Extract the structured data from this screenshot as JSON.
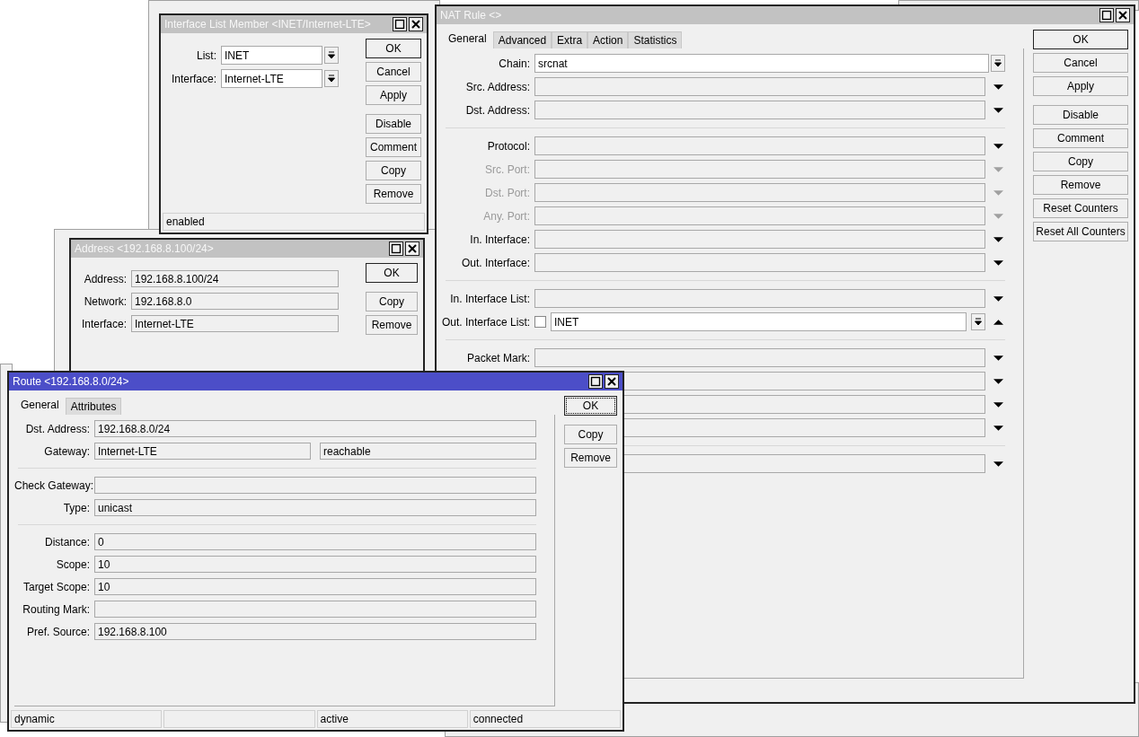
{
  "windows": [
    {
      "title": "Interface List Member <INET/Internet-LTE>",
      "active": false,
      "groups": [
        [
          {
            "kind": "combo",
            "label": "List:",
            "value": "INET",
            "disabled": false
          },
          {
            "kind": "combo",
            "label": "Interface:",
            "value": "Internet-LTE",
            "disabled": false
          }
        ]
      ],
      "button_groups": [
        [
          {
            "label": "OK",
            "default": true
          },
          {
            "label": "Cancel",
            "default": false
          },
          {
            "label": "Apply",
            "default": false
          }
        ],
        [
          {
            "label": "Disable",
            "default": false
          },
          {
            "label": "Comment",
            "default": false
          },
          {
            "label": "Copy",
            "default": false
          },
          {
            "label": "Remove",
            "default": false
          }
        ]
      ],
      "status_bar": [
        {
          "kind": "text",
          "text": "enabled"
        }
      ]
    },
    {
      "title": "NAT Rule <>",
      "active": false,
      "tabs": [
        {
          "label": "General",
          "selected": true
        },
        {
          "label": "Advanced",
          "selected": false
        },
        {
          "label": "Extra",
          "selected": false
        },
        {
          "label": "Action",
          "selected": false
        },
        {
          "label": "Statistics",
          "selected": false
        }
      ],
      "groups": [
        [
          {
            "kind": "combo",
            "label": "Chain:",
            "value": "srcnat",
            "disabled": false
          },
          {
            "kind": "dropdown",
            "label": "Src. Address:",
            "disabled": false
          },
          {
            "kind": "dropdown",
            "label": "Dst. Address:",
            "disabled": false
          }
        ],
        [
          {
            "kind": "dropdown",
            "label": "Protocol:",
            "disabled": false
          },
          {
            "kind": "dropdown",
            "label": "Src. Port:",
            "disabled": true
          },
          {
            "kind": "dropdown",
            "label": "Dst. Port:",
            "disabled": true
          },
          {
            "kind": "dropdown",
            "label": "Any. Port:",
            "disabled": true
          },
          {
            "kind": "dropdown",
            "label": "In. Interface:",
            "disabled": false
          },
          {
            "kind": "dropdown",
            "label": "Out. Interface:",
            "disabled": false
          }
        ],
        [
          {
            "kind": "dropdown",
            "label": "In. Interface List:",
            "disabled": false
          },
          {
            "kind": "negate",
            "label": "Out. Interface List:",
            "value": "INET",
            "checked": false,
            "disabled": false
          }
        ],
        [
          {
            "kind": "dropdown",
            "label": "Packet Mark:",
            "disabled": false
          },
          {
            "kind": "dropdown"
          },
          {
            "kind": "dropdown"
          },
          {
            "kind": "dropdown"
          }
        ],
        [
          {
            "kind": "dropdown"
          }
        ]
      ],
      "button_groups": [
        [
          {
            "label": "OK",
            "default": true
          },
          {
            "label": "Cancel",
            "default": false
          },
          {
            "label": "Apply",
            "default": false
          }
        ],
        [
          {
            "label": "Disable",
            "default": false
          },
          {
            "label": "Comment",
            "default": false
          },
          {
            "label": "Copy",
            "default": false
          },
          {
            "label": "Remove",
            "default": false
          },
          {
            "label": "Reset Counters",
            "default": false
          },
          {
            "label": "Reset All Counters",
            "default": false
          }
        ]
      ]
    },
    {
      "title": "Address <192.168.8.100/24>",
      "active": false,
      "groups": [
        [
          {
            "kind": "readonly",
            "label": "Address:",
            "value": "192.168.8.100/24",
            "disabled": false
          },
          {
            "kind": "readonly",
            "label": "Network:",
            "value": "192.168.8.0",
            "disabled": false
          },
          {
            "kind": "readonly",
            "label": "Interface:",
            "value": "Internet-LTE",
            "disabled": false
          }
        ]
      ],
      "button_groups": [
        [
          {
            "label": "OK",
            "default": true
          }
        ],
        [
          {
            "label": "Copy",
            "default": false
          },
          {
            "label": "Remove",
            "default": false
          }
        ]
      ]
    },
    {
      "title": "Route <192.168.8.0/24>",
      "active": true,
      "tabs": [
        {
          "label": "General",
          "selected": true
        },
        {
          "label": "Attributes",
          "selected": false
        }
      ],
      "groups": [
        [
          {
            "kind": "readonly",
            "label": "Dst. Address:",
            "value": "192.168.8.0/24",
            "disabled": false
          },
          {
            "kind": "pair",
            "label": "Gateway:",
            "values": [
              "Internet-LTE",
              "reachable"
            ],
            "disabled": false
          }
        ],
        [
          {
            "kind": "readonly",
            "label": "Check Gateway:",
            "disabled": false
          },
          {
            "kind": "readonly",
            "label": "Type:",
            "value": "unicast",
            "disabled": false
          }
        ],
        [
          {
            "kind": "readonly",
            "label": "Distance:",
            "value": "0",
            "disabled": false
          },
          {
            "kind": "readonly",
            "label": "Scope:",
            "value": "10",
            "disabled": false
          },
          {
            "kind": "readonly",
            "label": "Target Scope:",
            "value": "10",
            "disabled": false
          },
          {
            "kind": "readonly",
            "label": "Routing Mark:",
            "disabled": false
          },
          {
            "kind": "readonly",
            "label": "Pref. Source:",
            "value": "192.168.8.100",
            "disabled": false
          }
        ]
      ],
      "button_groups": [
        [
          {
            "label": "OK",
            "default": true
          }
        ],
        [
          {
            "label": "Copy",
            "default": false
          },
          {
            "label": "Remove",
            "default": false
          }
        ]
      ],
      "status_bar": [
        {
          "kind": "text",
          "text": "dynamic"
        },
        {
          "kind": "blank"
        },
        {
          "kind": "text",
          "text": "active"
        },
        {
          "kind": "text",
          "text": "connected"
        }
      ]
    }
  ]
}
